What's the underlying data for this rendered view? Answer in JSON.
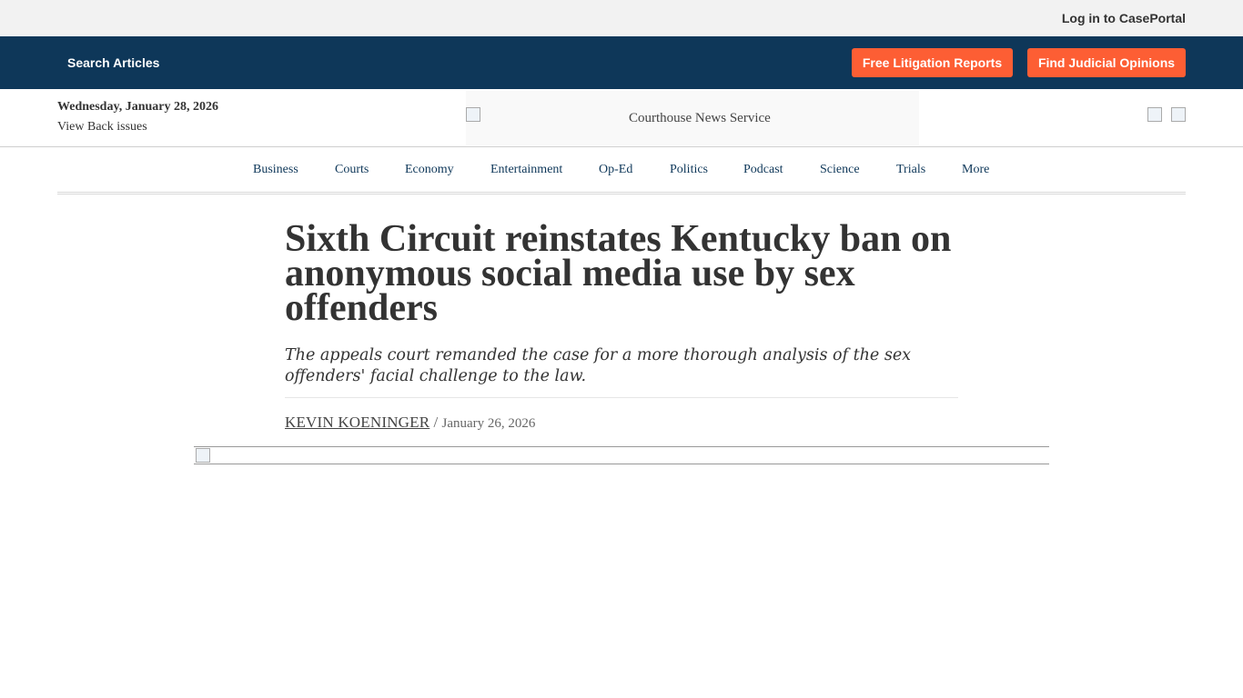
{
  "topbar": {
    "login_label": "Log in to CasePortal"
  },
  "navbar": {
    "search_label": "Search Articles",
    "free_reports_label": "Free Litigation Reports",
    "find_opinions_label": "Find Judicial Opinions",
    "background_color": "#0e3759",
    "button_color": "#fd5e34"
  },
  "masthead": {
    "date": "Wednesday, January 28, 2026",
    "back_issues": "View Back issues",
    "logo_alt": "Courthouse News Service",
    "social_icons": [
      "social-icon-1",
      "social-icon-2"
    ]
  },
  "sections": [
    "Business",
    "Courts",
    "Economy",
    "Entertainment",
    "Op-Ed",
    "Politics",
    "Podcast",
    "Science",
    "Trials",
    "More"
  ],
  "article": {
    "headline": "Sixth Circuit reinstates Kentucky ban on anonymous social media use by sex offenders",
    "dek": "The appeals court remanded the case for a more thorough analysis of the sex offenders' facial challenge to the law.",
    "author": "KEVIN KOENINGER",
    "separator": "/",
    "date": "January 26, 2026"
  }
}
